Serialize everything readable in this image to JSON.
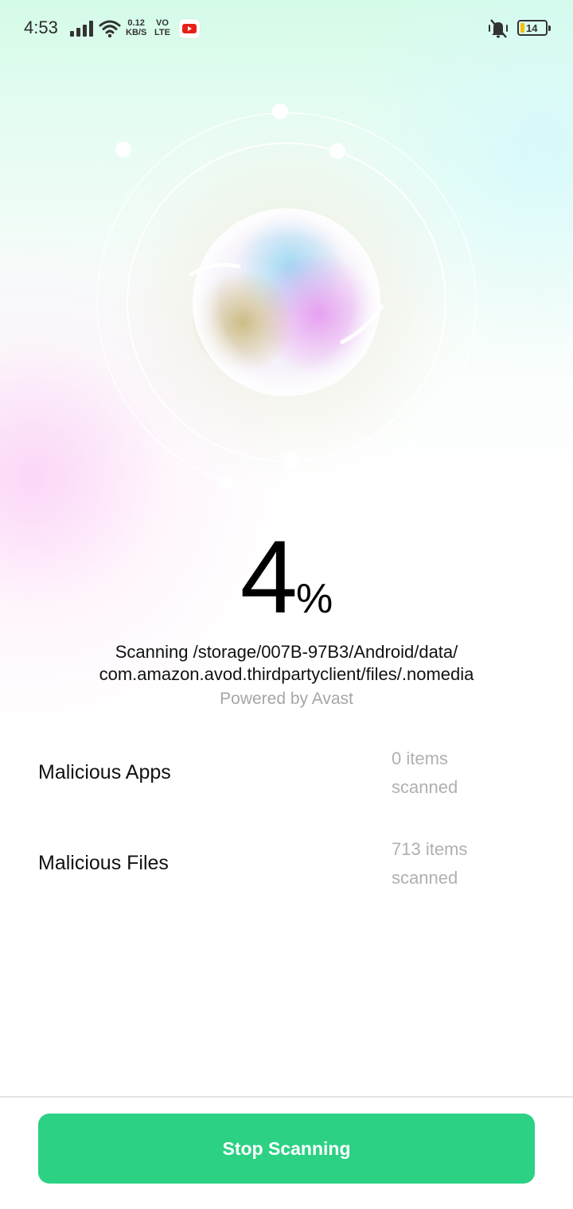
{
  "status_bar": {
    "time": "4:53",
    "net_speed_value": "0.12",
    "net_speed_unit": "KB/S",
    "volte_top": "VO",
    "volte_bottom": "LTE",
    "battery_level": "14",
    "icons": [
      "signal-icon",
      "wifi-icon",
      "youtube-icon",
      "mute-icon",
      "battery-icon"
    ]
  },
  "scan": {
    "progress_value": "4",
    "progress_unit": "%",
    "path_line1": "Scanning /storage/007B-97B3/Android/data/",
    "path_line2": "com.amazon.avod.thirdpartyclient/files/.nomedia",
    "powered_by": "Powered by Avast"
  },
  "results": [
    {
      "label": "Malicious Apps",
      "count_line1": "0 items",
      "count_line2": "scanned"
    },
    {
      "label": "Malicious Files",
      "count_line1": "713 items",
      "count_line2": "scanned"
    }
  ],
  "actions": {
    "stop_label": "Stop Scanning"
  },
  "colors": {
    "accent": "#2cd184",
    "muted_text": "#a6a6a6"
  }
}
